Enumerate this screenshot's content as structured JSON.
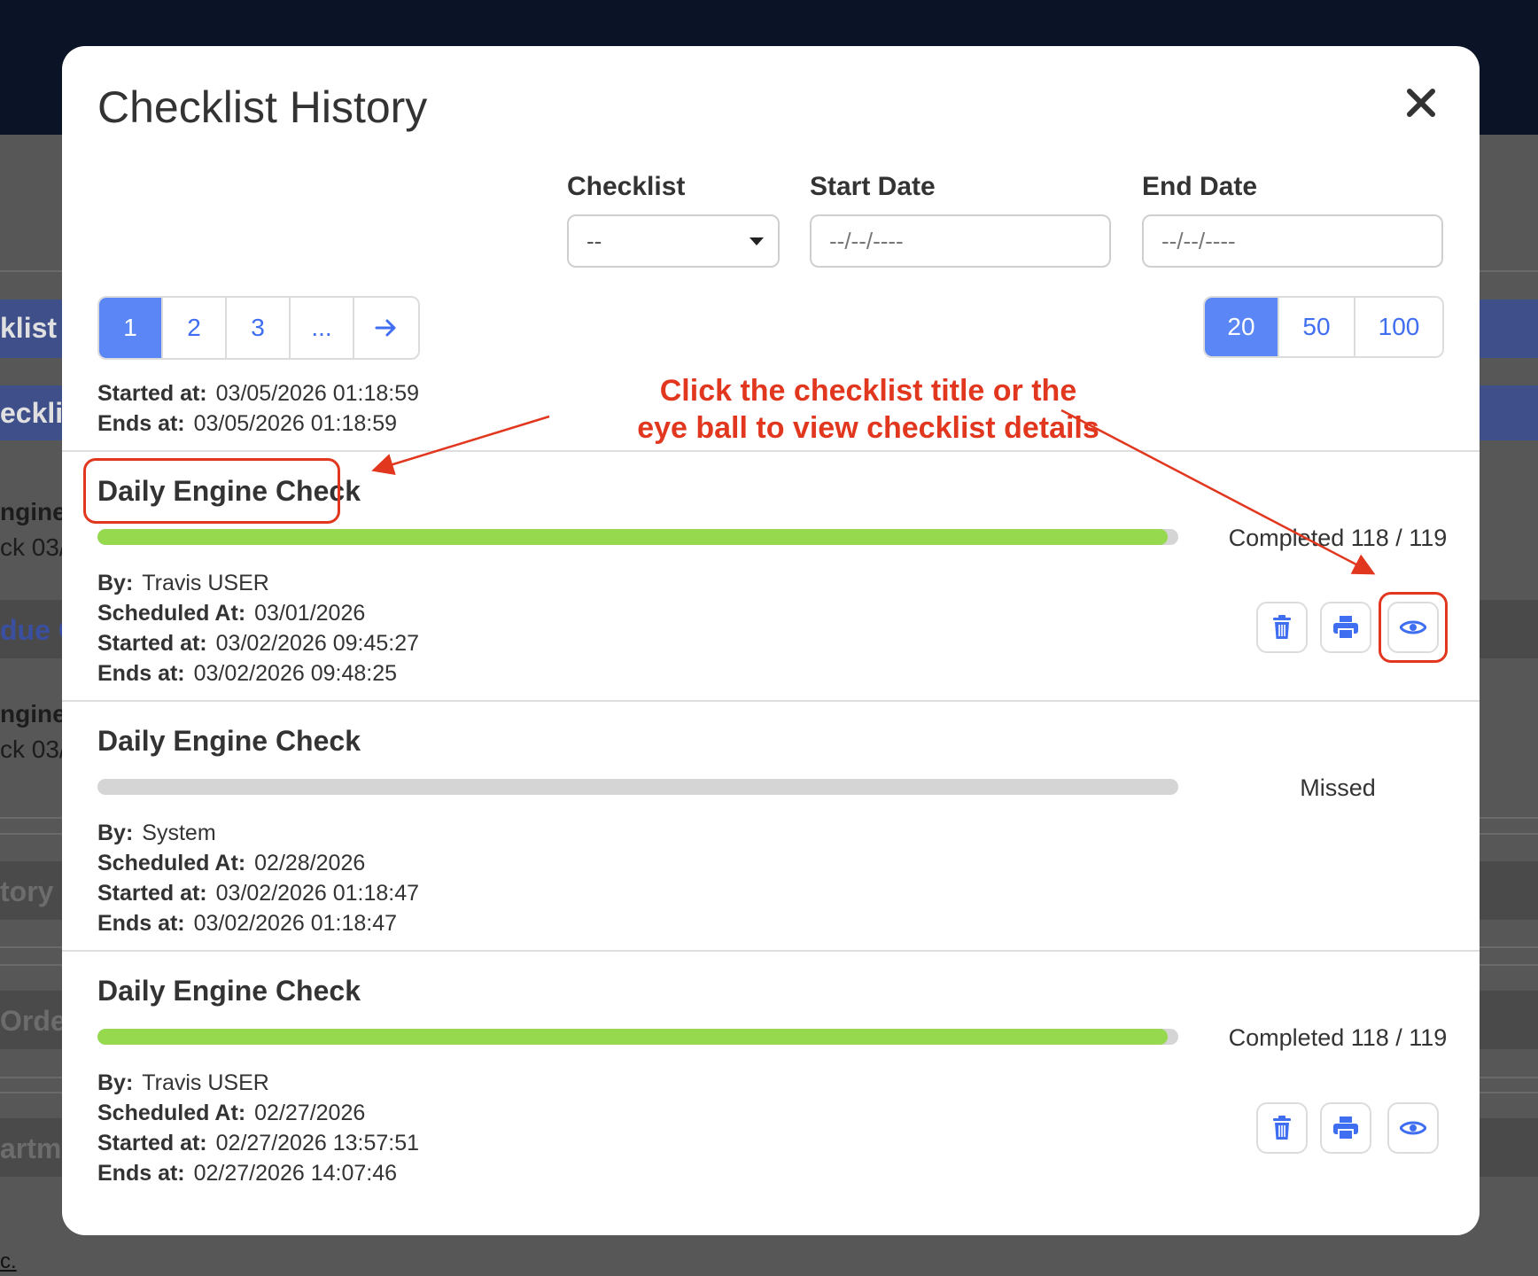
{
  "background": {
    "fragments": [
      "klist",
      "ecklis",
      "ngine",
      "ck  03/",
      "due C",
      "ngine",
      "ck  03/",
      "tory U",
      "Orde",
      "artm"
    ],
    "footer": "c."
  },
  "modal": {
    "title": "Checklist History",
    "close_icon": "close-icon"
  },
  "filters": {
    "checklist_label": "Checklist",
    "checklist_value": "--",
    "start_label": "Start Date",
    "start_placeholder": "--/--/----",
    "end_label": "End Date",
    "end_placeholder": "--/--/----"
  },
  "pagination": {
    "pages": [
      "1",
      "2",
      "3",
      "..."
    ],
    "next_icon": "arrow-right-icon",
    "active_page": "1"
  },
  "page_sizes": {
    "options": [
      "20",
      "50",
      "100"
    ],
    "active": "20"
  },
  "top_partial": {
    "started_label": "Started at:",
    "started_value": "03/05/2026 01:18:59",
    "ends_label": "Ends at:",
    "ends_value": "03/05/2026 01:18:59"
  },
  "annotation": {
    "line1": "Click the checklist title or the",
    "line2": "eye ball to view checklist details",
    "color": "#e2371f"
  },
  "labels": {
    "by": "By:",
    "scheduled": "Scheduled At:",
    "started": "Started at:",
    "ends": "Ends at:"
  },
  "entries": [
    {
      "title": "Daily Engine Check",
      "progress": 0.99,
      "status": "Completed 118 / 119",
      "by": "Travis USER",
      "scheduled": "03/01/2026",
      "started": "03/02/2026 09:45:27",
      "ends": "03/02/2026 09:48:25"
    },
    {
      "title": "Daily Engine Check",
      "progress": 0,
      "status": "Missed",
      "by": "System",
      "scheduled": "02/28/2026",
      "started": "03/02/2026 01:18:47",
      "ends": "03/02/2026 01:18:47"
    },
    {
      "title": "Daily Engine Check",
      "progress": 0.99,
      "status": "Completed 118 / 119",
      "by": "Travis USER",
      "scheduled": "02/27/2026",
      "started": "02/27/2026 13:57:51",
      "ends": "02/27/2026 14:07:46"
    }
  ],
  "colors": {
    "accent": "#5b86f5",
    "progress_fill": "#96d84e",
    "progress_track": "#d5d5d5"
  }
}
